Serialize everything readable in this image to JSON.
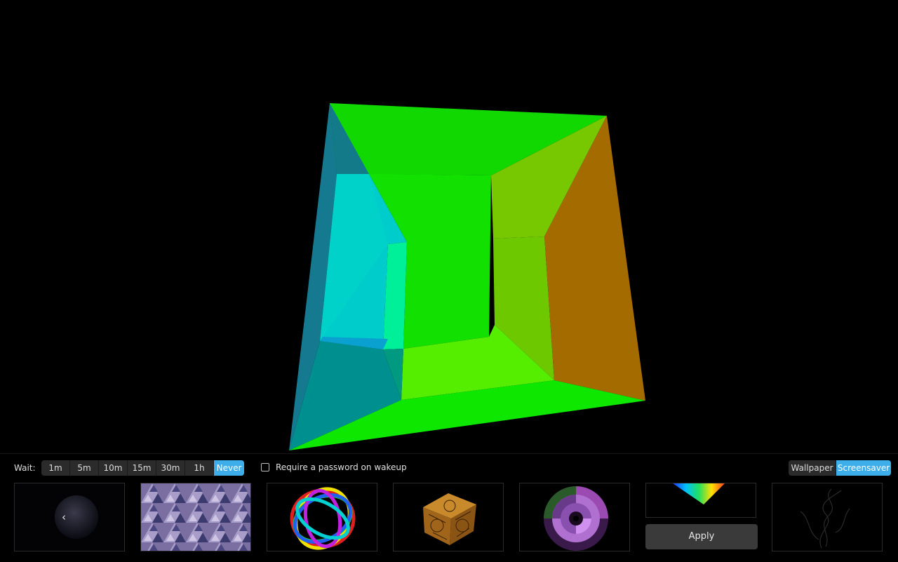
{
  "wait": {
    "label": "Wait:",
    "options": [
      "1m",
      "5m",
      "10m",
      "15m",
      "30m",
      "1h",
      "Never"
    ],
    "selected": "Never"
  },
  "password": {
    "label": "Require a password on wakeup",
    "checked": false
  },
  "mode": {
    "options": [
      "Wallpaper",
      "Screensaver"
    ],
    "selected": "Screensaver"
  },
  "apply_label": "Apply",
  "prev_arrow": "‹",
  "thumbnails": [
    {
      "name": "dark-planet",
      "selected": false
    },
    {
      "name": "triangle-pattern",
      "selected": false
    },
    {
      "name": "rainbow-torus",
      "selected": false
    },
    {
      "name": "puzzle-cube",
      "selected": false
    },
    {
      "name": "purple-rings",
      "selected": false
    },
    {
      "name": "rainbow-prism",
      "selected": true
    },
    {
      "name": "smoke-wisp",
      "selected": false
    }
  ],
  "colors": {
    "accent": "#3daee9",
    "background": "#000000",
    "button": "#2b2b2b"
  }
}
